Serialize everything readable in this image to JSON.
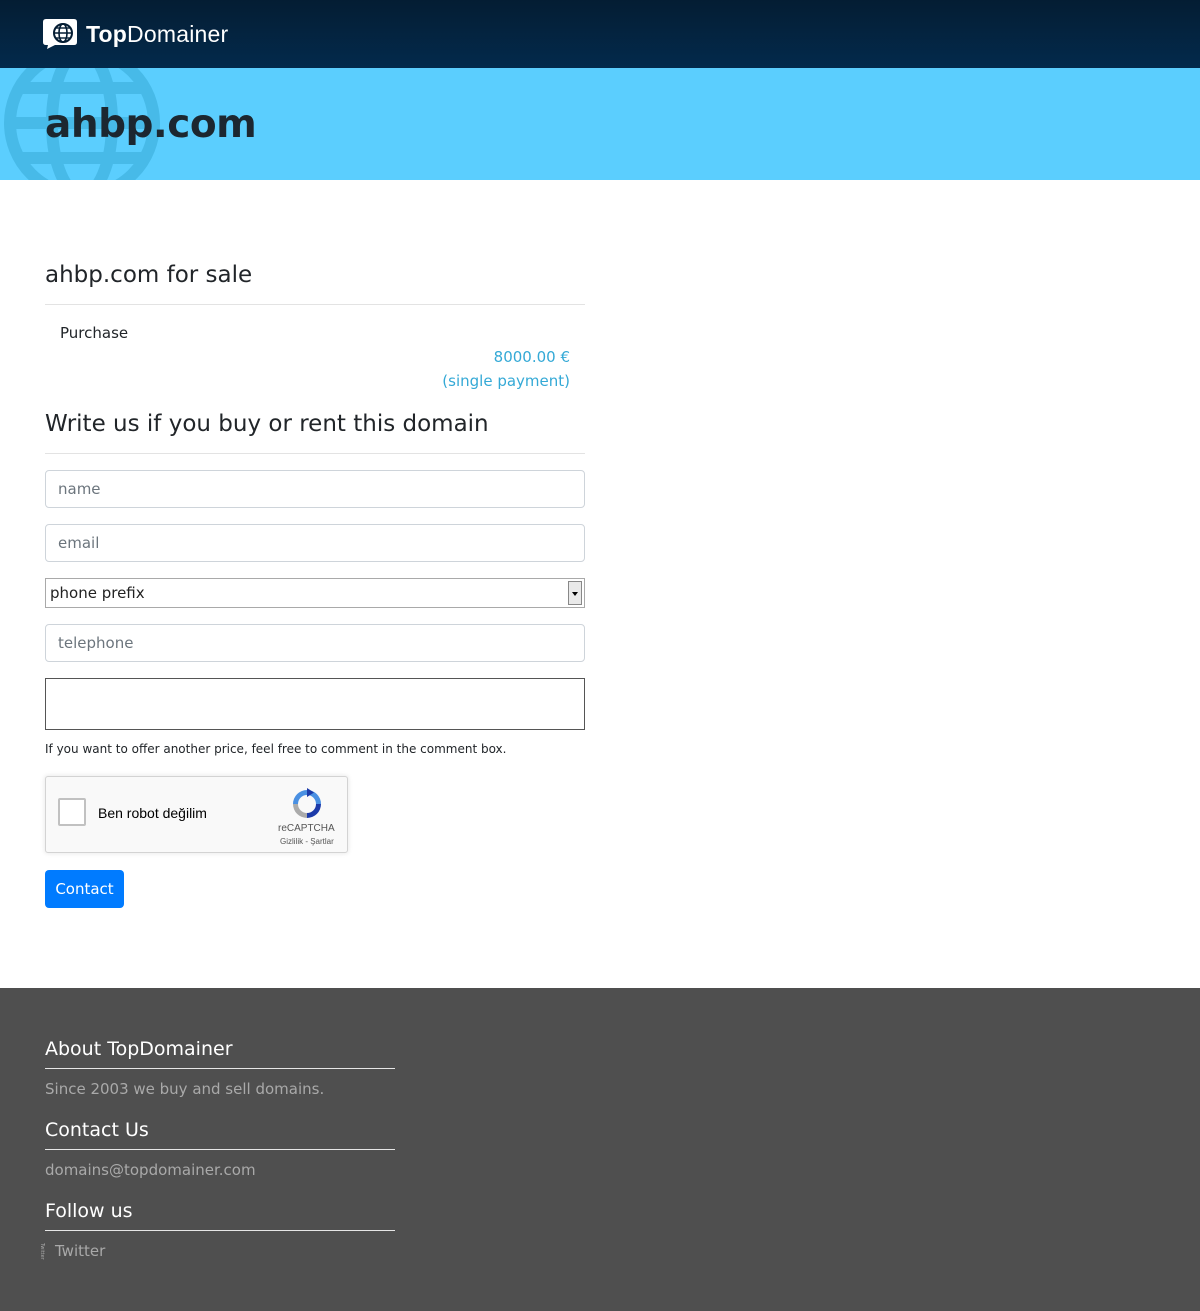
{
  "header": {
    "brand_bold": "Top",
    "brand_rest": "Domainer",
    "logo_icon": "globe-hand-icon"
  },
  "hero": {
    "title": "ahbp.com",
    "background_color": "#5bcefe"
  },
  "sale": {
    "title": "ahbp.com for sale",
    "purchase_label": "Purchase",
    "price": "8000.00 €",
    "price_note": "(single payment)"
  },
  "form": {
    "title": "Write us if you buy or rent this domain",
    "name_placeholder": "name",
    "email_placeholder": "email",
    "phone_prefix_selected": "phone prefix",
    "telephone_placeholder": "telephone",
    "hint": "If you want to offer another price, feel free to comment in the comment box.",
    "captcha_label": "Ben robot değilim",
    "captcha_brand": "reCAPTCHA",
    "captcha_links": "Gizlilik - Şartlar",
    "contact_button": "Contact"
  },
  "footer": {
    "about_title": "About TopDomainer",
    "about_text": "Since 2003 we buy and sell domains.",
    "contact_title": "Contact Us",
    "contact_email": "domains@topdomainer.com",
    "follow_title": "Follow us",
    "twitter_icon_alt": "Twitter",
    "twitter_label": "Twitter"
  },
  "colors": {
    "navbar": "#032a4c",
    "accent": "#34a9d6",
    "button": "#007bff",
    "footer": "#4f4f4f"
  }
}
